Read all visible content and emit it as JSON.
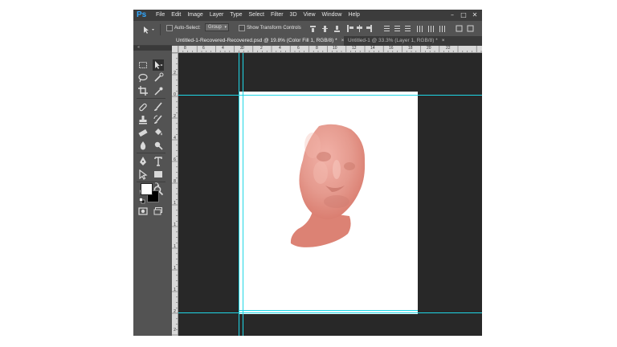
{
  "app": {
    "logo": "Ps",
    "menu": [
      "File",
      "Edit",
      "Image",
      "Layer",
      "Type",
      "Select",
      "Filter",
      "3D",
      "View",
      "Window",
      "Help"
    ],
    "window_controls": [
      "–",
      "□",
      "✕"
    ]
  },
  "options_bar": {
    "auto_select_label": "Auto-Select:",
    "auto_select_value": "Group",
    "transform_label": "Show Transform Controls"
  },
  "tabs": [
    {
      "title": "Untitled-1-Recovered-Recovered.psd @ 19.8% (Color Fill 1, RGB/8) *",
      "close": "×"
    },
    {
      "title": "Untitled-1 @ 33.3% (Layer 1, RGB/8) *",
      "close": "×"
    }
  ],
  "rulers": {
    "horizontal": [
      "8",
      "6",
      "4",
      "2",
      "0",
      "2",
      "4",
      "6",
      "8",
      "10",
      "12",
      "14",
      "16",
      "18",
      "20",
      "22"
    ],
    "vertical": [
      "2",
      "0",
      "2",
      "4",
      "6",
      "8",
      "1",
      "1",
      "1",
      "1",
      "1",
      "2",
      "2"
    ]
  },
  "colors": {
    "accent": "#31a8ff",
    "guide": "#1fd6e6",
    "face": "#dc8274",
    "canvas_bg": "#282828",
    "panel_bg": "#535353"
  },
  "tools": [
    "move-tool",
    "artboard-tool",
    "marquee-tool",
    "lasso-tool",
    "quick-selection-tool",
    "crop-tool",
    "eyedropper-tool",
    "healing-brush-tool",
    "brush-tool",
    "clone-stamp-tool",
    "history-brush-tool",
    "eraser-tool",
    "paint-bucket-tool",
    "blur-tool",
    "dodge-tool",
    "pen-tool",
    "type-tool",
    "path-selection-tool",
    "rectangle-tool",
    "hand-tool",
    "zoom-tool",
    "foreground-color",
    "background-color",
    "quick-mask-tool",
    "screen-mode-tool"
  ]
}
